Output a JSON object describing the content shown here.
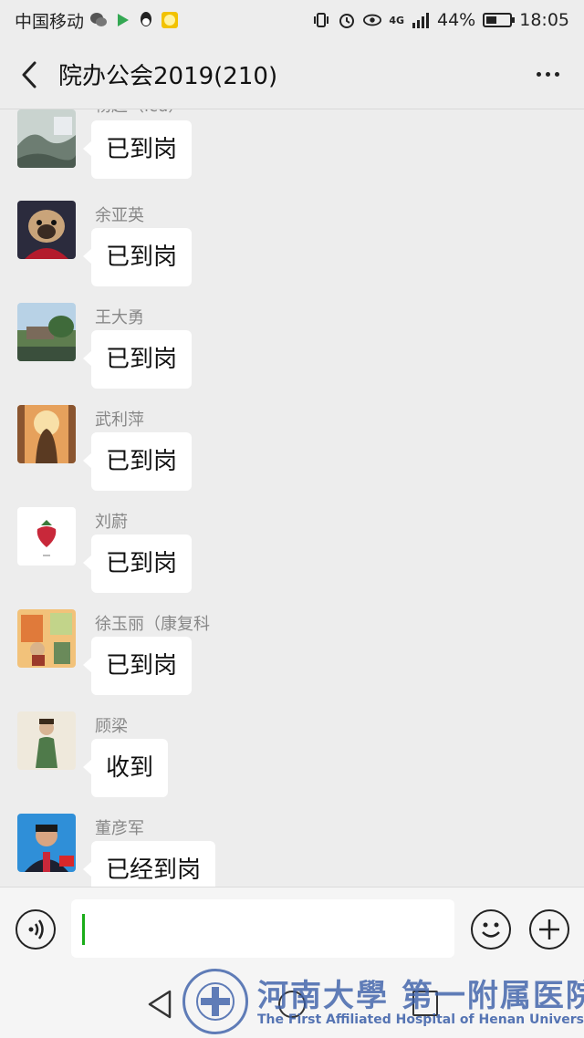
{
  "status_bar": {
    "carrier": "中国移动",
    "network": "4G",
    "battery": "44%",
    "battery_level": 0.44,
    "time": "18:05",
    "icons": [
      "wechat-icon",
      "play-icon",
      "qq-icon",
      "emoji-app-icon",
      "vibrate-icon",
      "alarm-icon",
      "eye-icon",
      "signal-icon",
      "battery-icon"
    ]
  },
  "header": {
    "title": "院办公会2019(210)"
  },
  "messages": [
    {
      "sender": "杨超（icu）",
      "text": "已到岗",
      "avatar": "landscape-avatar"
    },
    {
      "sender": "余亚英",
      "text": "已到岗",
      "avatar": "pug-avatar"
    },
    {
      "sender": "王大勇",
      "text": "已到岗",
      "avatar": "garden-avatar"
    },
    {
      "sender": "武利萍",
      "text": "已到岗",
      "avatar": "sunset-avatar"
    },
    {
      "sender": "刘蔚",
      "text": "已到岗",
      "avatar": "strawberry-avatar"
    },
    {
      "sender": "徐玉丽（康复科",
      "text": "已到岗",
      "avatar": "illustration-avatar"
    },
    {
      "sender": "顾梁",
      "text": "收到",
      "avatar": "child-avatar"
    },
    {
      "sender": "董彦军",
      "text": "已经到岗",
      "avatar": "man-avatar"
    }
  ],
  "watermark": {
    "cn": "河南大學 第一附属医院",
    "en": "The First Affiliated Hospital of Henan University"
  },
  "colors": {
    "background": "#ededed",
    "bubble": "#ffffff",
    "cursor": "#1aad19",
    "watermark": "#3a5ea8"
  }
}
